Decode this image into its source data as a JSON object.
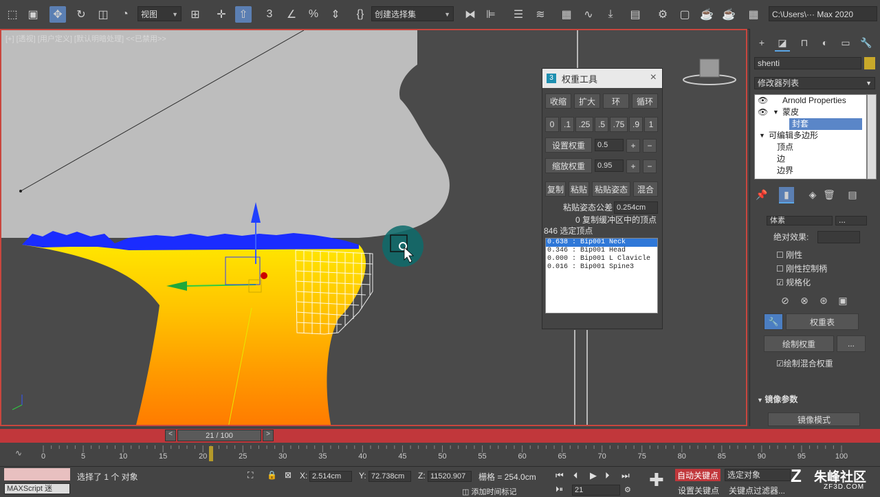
{
  "toolbar": {
    "view_dropdown": "视图",
    "selection_set_dropdown": "创建选择集",
    "workspace_path": "C:\\Users\\··· Max 2020"
  },
  "viewport": {
    "label": "[+] [透视] [用户定义] [默认明暗处理] <<已禁用>>"
  },
  "weight_tool": {
    "title": "权重工具",
    "close": "×",
    "buttons_row1": [
      "收缩",
      "扩大",
      "环",
      "循环"
    ],
    "weight_presets": [
      "0",
      ".1",
      ".25",
      ".5",
      ".75",
      ".9",
      "1"
    ],
    "set_weight_label": "设置权重",
    "set_weight_value": "0.5",
    "scale_weight_label": "缩放权重",
    "scale_weight_value": "0.95",
    "plus": "+",
    "minus": "−",
    "buttons_row3": [
      "复制",
      "粘贴",
      "粘贴姿态",
      "混合"
    ],
    "paste_tolerance_label": "粘贴姿态公差",
    "paste_tolerance_value": "0.254cm",
    "buffer_text": "0 复制缓冲区中的顶点",
    "selected_text": "846 选定顶点",
    "influences": [
      "0.638 : Bip001 Neck",
      "0.346 : Bip001 Head",
      "0.000 : Bip001 L Clavicle",
      "0.016 : Bip001 Spine3"
    ]
  },
  "command_panel": {
    "object_name": "shenti",
    "modifier_list": "修改器列表",
    "stack": [
      {
        "label": "Arnold Properties",
        "eye": true
      },
      {
        "label": "蒙皮",
        "eye": true
      },
      {
        "label": "封套",
        "selected": true
      },
      {
        "label": "可编辑多边形"
      },
      {
        "label": "顶点"
      },
      {
        "label": "边"
      },
      {
        "label": "边界"
      }
    ],
    "rollout_dropdown": "体素",
    "absolute_effect_label": "绝对效果:",
    "rigid": "刚性",
    "rigid_handles": "刚性控制柄",
    "normalize": "规格化",
    "weight_table": "权重表",
    "paint_weights": "绘制权重",
    "ellipsis": "...",
    "paint_blend": "绘制混合权重",
    "mirror_section": "镜像参数",
    "mirror_mode": "镜像模式"
  },
  "timeline": {
    "frame_display": "21 / 100",
    "ticks": [
      "0",
      "5",
      "10",
      "15",
      "20",
      "25",
      "30",
      "35",
      "40",
      "45",
      "50",
      "55",
      "60",
      "65",
      "70",
      "75",
      "80",
      "85",
      "90",
      "95",
      "100"
    ],
    "current_frame": 21
  },
  "status": {
    "maxscript": "MAXScript 迷",
    "selected": "选择了 1 个 对象",
    "x_label": "X:",
    "x_value": "2.514cm",
    "y_label": "Y:",
    "y_value": "72.738cm",
    "z_label": "Z:",
    "z_value": "11520.907",
    "grid": "栅格 = 254.0cm",
    "auto_key": "自动关键点",
    "selected_obj": "选定对象",
    "set_key": "设置关键点",
    "key_filter": "关键点过滤器...",
    "add_time_tag": "添加时间标记",
    "frame_field": "21",
    "watermark_main": "朱峰社区",
    "watermark_sub": "ZF3D.COM"
  }
}
